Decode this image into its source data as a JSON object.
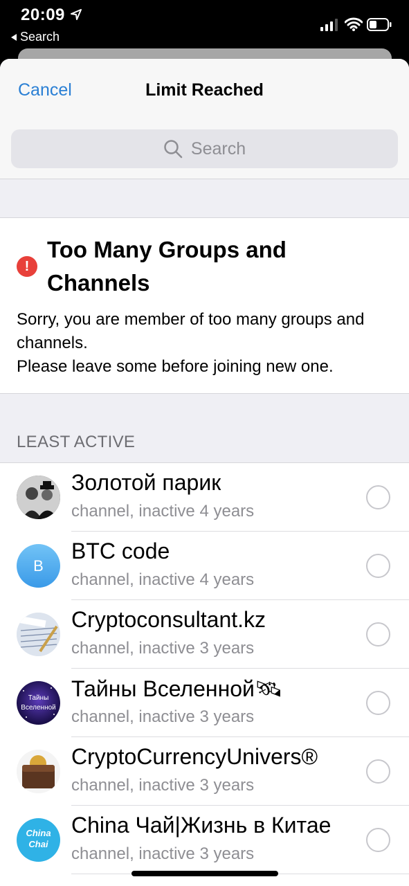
{
  "status_bar": {
    "time": "20:09",
    "back_app": "Search"
  },
  "nav": {
    "cancel": "Cancel",
    "title": "Limit Reached"
  },
  "search": {
    "placeholder": "Search"
  },
  "alert": {
    "icon": "!",
    "title": "Too Many Groups and Channels",
    "body_line1": "Sorry, you are member of too many groups and channels.",
    "body_line2": "Please leave some before joining new one."
  },
  "section": {
    "header": "LEAST ACTIVE"
  },
  "channels": [
    {
      "name": "Золотой парик",
      "subtitle": "channel, inactive 4 years",
      "avatar": "photo"
    },
    {
      "name": "BTC code",
      "subtitle": "channel, inactive 4 years",
      "avatar_letter": "B"
    },
    {
      "name": "Cryptoconsultant.kz",
      "subtitle": "channel, inactive 3 years",
      "avatar": "trading-photo"
    },
    {
      "name": "Тайны Вселенной🛰",
      "subtitle": "channel, inactive 3 years",
      "avatar_text": "Тайны Вселенной"
    },
    {
      "name": "CryptoCurrencyUnivers®",
      "subtitle": "channel, inactive 3 years",
      "avatar": "wallet-photo"
    },
    {
      "name": "China Чай|Жизнь в Китае",
      "subtitle": "channel, inactive 3 years",
      "avatar_text": "China Chai"
    }
  ],
  "colors": {
    "accent": "#2a7fd4",
    "alert": "#e8403a"
  }
}
